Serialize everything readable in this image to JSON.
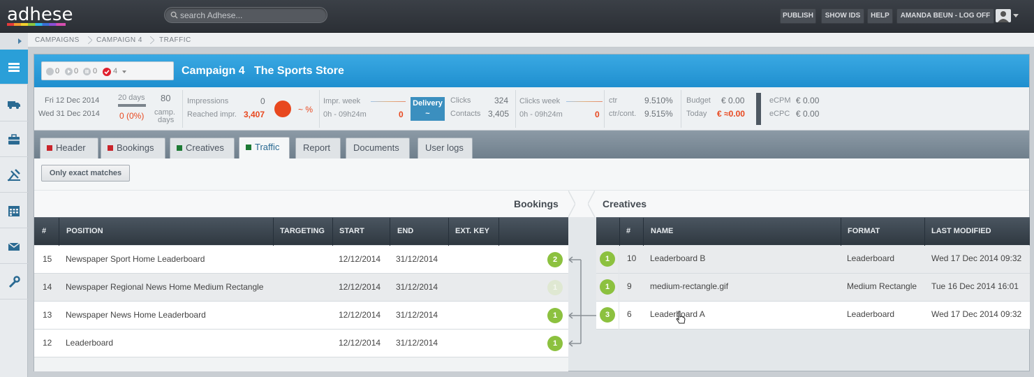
{
  "app": {
    "logo": "adhese",
    "search_placeholder": "search Adhese...",
    "top_buttons": [
      "PUBLISH",
      "SHOW IDS",
      "HELP",
      "AMANDA BEUN - LOG OFF"
    ]
  },
  "sidebar": {
    "items": [
      "campaigns-icon",
      "truck-icon",
      "briefcase-icon",
      "tools-icon",
      "calendar-icon",
      "mail-icon",
      "wrench-icon"
    ]
  },
  "breadcrumb": [
    "CAMPAIGNS",
    "CAMPAIGN 4",
    "TRAFFIC"
  ],
  "campaign": {
    "status": {
      "grey": "0",
      "play": "0",
      "pause": "0",
      "checked": "4"
    },
    "name": "Campaign 4",
    "advertiser": "The Sports Store"
  },
  "stats": {
    "start_date": "Fri 12 Dec 2014",
    "end_date": "Wed 31 Dec 2014",
    "days_total": "20 days",
    "days_left": "0 (0%)",
    "camp_days_value": "80",
    "camp_days_label_1": "camp.",
    "camp_days_label_2": "days",
    "impressions_label": "Impressions",
    "impressions_value": "0",
    "reached_label": "Reached impr.",
    "reached_value": "3,407",
    "pct": "~ %",
    "impr_week_label": "Impr. week",
    "impr_week_range": "0h - 09h24m",
    "impr_week_value": "0",
    "delivery_label": "Delivery",
    "delivery_value": "~",
    "clicks_label": "Clicks",
    "clicks_value": "324",
    "contacts_label": "Contacts",
    "contacts_value": "3,405",
    "clicks_week_label": "Clicks week",
    "clicks_week_range": "0h - 09h24m",
    "clicks_week_value": "0",
    "ctr_label": "ctr",
    "ctr_value": "9.510%",
    "ctr_cont_label": "ctr/cont.",
    "ctr_cont_value": "9.515%",
    "budget_label": "Budget",
    "budget_value": "€ 0.00",
    "today_label": "Today",
    "today_value": "€ ≈0.00",
    "ecpm_label": "eCPM",
    "ecpm_value": "€ 0.00",
    "ecpc_label": "eCPC",
    "ecpc_value": "€ 0.00"
  },
  "tabs": [
    "Header",
    "Bookings",
    "Creatives",
    "Traffic",
    "Report",
    "Documents",
    "User logs"
  ],
  "active_tab": "Traffic",
  "toolbar": {
    "exact_button": "Only exact matches"
  },
  "bookings": {
    "title": "Bookings",
    "columns": [
      "#",
      "POSITION",
      "TARGETING",
      "START",
      "END",
      "EXT. KEY"
    ],
    "rows": [
      {
        "id": "15",
        "position": "Newspaper Sport Home Leaderboard",
        "targeting": "",
        "start": "12/12/2014",
        "end": "31/12/2014",
        "ext_key": "",
        "count": "2"
      },
      {
        "id": "14",
        "position": "Newspaper Regional News Home Medium Rectangle",
        "targeting": "",
        "start": "12/12/2014",
        "end": "31/12/2014",
        "ext_key": "",
        "count": "1"
      },
      {
        "id": "13",
        "position": "Newspaper News Home Leaderboard",
        "targeting": "",
        "start": "12/12/2014",
        "end": "31/12/2014",
        "ext_key": "",
        "count": "1"
      },
      {
        "id": "12",
        "position": "Leaderboard",
        "targeting": "",
        "start": "12/12/2014",
        "end": "31/12/2014",
        "ext_key": "",
        "count": "1"
      }
    ]
  },
  "creatives": {
    "title": "Creatives",
    "columns": [
      "#",
      "NAME",
      "FORMAT",
      "LAST MODIFIED"
    ],
    "rows": [
      {
        "count": "1",
        "id": "10",
        "name": "Leaderboard B",
        "format": "Leaderboard",
        "modified": "Wed 17 Dec 2014 09:32"
      },
      {
        "count": "1",
        "id": "9",
        "name": "medium-rectangle.gif",
        "format": "Medium Rectangle",
        "modified": "Tue 16 Dec 2014 16:01"
      },
      {
        "count": "3",
        "id": "6",
        "name": "Leaderboard A",
        "format": "Leaderboard",
        "modified": "Wed 17 Dec 2014 09:32"
      }
    ]
  },
  "colors": {
    "accent": "#2a9fd8",
    "badge": "#8cc13f",
    "alert": "#e8481f"
  }
}
